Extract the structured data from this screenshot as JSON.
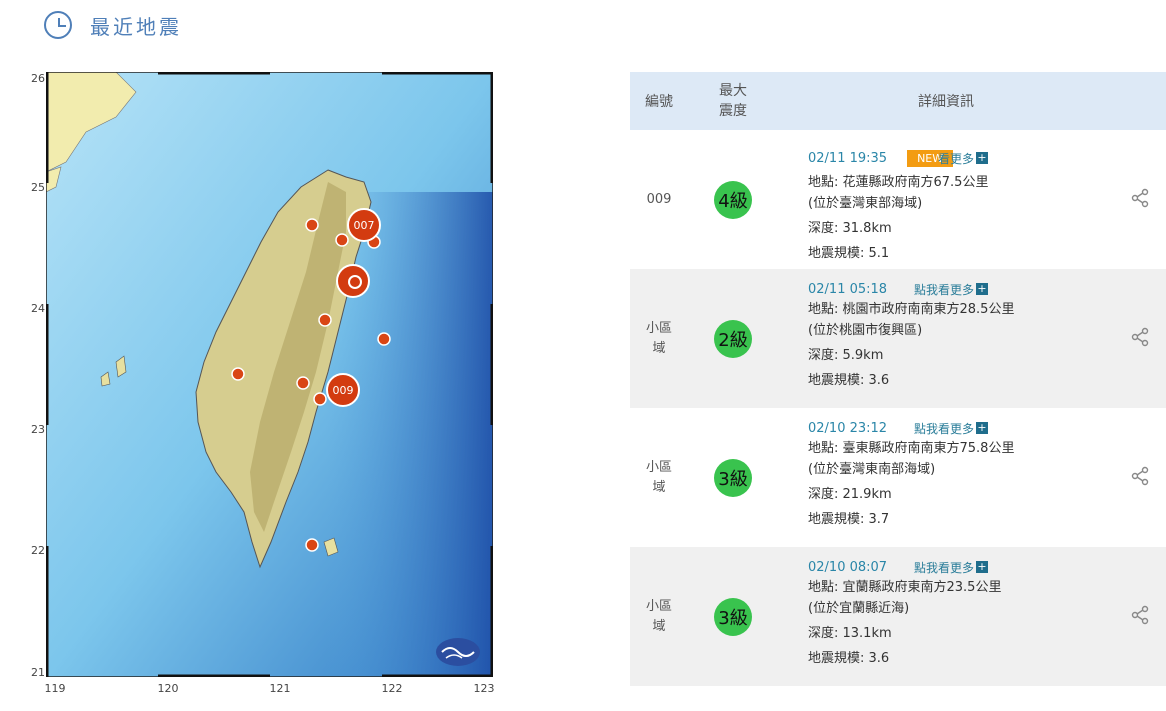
{
  "header": {
    "title": "最近地震",
    "icon": "clock-icon"
  },
  "map": {
    "y_ticks": [
      "26",
      "25",
      "24",
      "23",
      "22",
      "21"
    ],
    "x_ticks": [
      "119",
      "120",
      "121",
      "122",
      "123"
    ],
    "labels": {
      "e007": "007",
      "e009": "009"
    }
  },
  "table": {
    "headers": {
      "id": "編號",
      "intensity": "最大\n震度",
      "detail": "詳細資訊"
    },
    "rows": [
      {
        "id": "009",
        "intensity": "4級",
        "time": "02/11 19:35",
        "new": "NEW",
        "more": "看更多",
        "location": "地點: 花蓮縣政府南方67.5公里",
        "region": "(位於臺灣東部海域)",
        "depth": "深度: 31.8km",
        "magnitude": "地震規模: 5.1"
      },
      {
        "id": "小區\n域",
        "intensity": "2級",
        "time": "02/11 05:18",
        "more": "點我看更多",
        "location": "地點: 桃園市政府南南東方28.5公里",
        "region": "(位於桃園市復興區)",
        "depth": "深度: 5.9km",
        "magnitude": "地震規模: 3.6"
      },
      {
        "id": "小區\n域",
        "intensity": "3級",
        "time": "02/10 23:12",
        "more": "點我看更多",
        "location": "地點: 臺東縣政府南南東方75.8公里",
        "region": "(位於臺灣東南部海域)",
        "depth": "深度: 21.9km",
        "magnitude": "地震規模: 3.7"
      },
      {
        "id": "小區\n域",
        "intensity": "3級",
        "time": "02/10 08:07",
        "more": "點我看更多",
        "location": "地點: 宜蘭縣政府東南方23.5公里",
        "region": "(位於宜蘭縣近海)",
        "depth": "深度: 13.1km",
        "magnitude": "地震規模: 3.6"
      }
    ]
  }
}
